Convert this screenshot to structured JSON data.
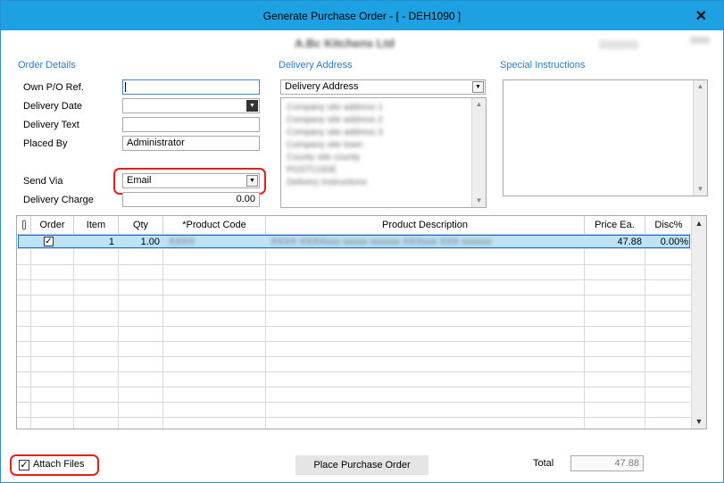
{
  "window": {
    "title": "Generate Purchase Order - [  - DEH1090 ]",
    "close_glyph": "✕",
    "supplier_name": "A.Bc Kitchens Ltd"
  },
  "order_details": {
    "section_label": "Order Details",
    "own_po_label": "Own P/O Ref.",
    "own_po_value": "",
    "delivery_date_label": "Delivery Date",
    "delivery_date_value": "",
    "delivery_text_label": "Delivery Text",
    "delivery_text_value": "",
    "placed_by_label": "Placed By",
    "placed_by_value": "Administrator",
    "send_via_label": "Send Via",
    "send_via_value": "Email",
    "delivery_charge_label": "Delivery Charge",
    "delivery_charge_value": "0.00"
  },
  "delivery_address": {
    "section_label": "Delivery Address",
    "selected": "Delivery Address",
    "lines": [
      "Company site address 1",
      "Company site address 2",
      "Company site address 3",
      "Company site town",
      "County site county",
      "POSTCODE",
      "Delivery Instructions"
    ]
  },
  "special_instructions": {
    "section_label": "Special Instructions",
    "value": ""
  },
  "grid": {
    "columns": [
      {
        "key": "attach",
        "label": ""
      },
      {
        "key": "order",
        "label": "Order"
      },
      {
        "key": "item",
        "label": "Item"
      },
      {
        "key": "qty",
        "label": "Qty"
      },
      {
        "key": "product_code",
        "label": "*Product Code"
      },
      {
        "key": "product_description",
        "label": "Product Description"
      },
      {
        "key": "price_ea",
        "label": "Price Ea."
      },
      {
        "key": "disc",
        "label": "Disc%"
      }
    ],
    "rows": [
      {
        "order": true,
        "item": "1",
        "qty": "1.00",
        "product_code": "XXXX",
        "product_description": "XXXX XXXXxxx xxxxx xxxxxx XXXxxx XXX xxxxxx",
        "price_ea": "47.88",
        "disc": "0.00%"
      }
    ],
    "empty_row_count": 11
  },
  "footer": {
    "attach_files_label": "Attach Files",
    "attach_files_checked": true,
    "place_order_label": "Place Purchase Order",
    "total_label": "Total",
    "total_value": "47.88"
  },
  "colors": {
    "title_bar": "#1ea1e3",
    "section_label": "#2e7cc5",
    "highlight_box": "#e31e1e",
    "selected_row": "#bde3f7"
  },
  "icons": {
    "attach_column": "paperclip-icon",
    "scroll_up": "triangle-up",
    "scroll_down": "triangle-down",
    "dropdown": "triangle-down",
    "check": "check-icon"
  }
}
